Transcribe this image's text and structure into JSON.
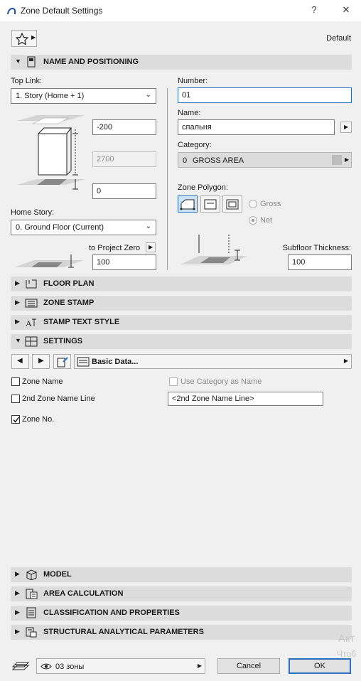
{
  "window": {
    "title": "Zone Default Settings",
    "help": "?",
    "close": "✕"
  },
  "header": {
    "preset": "Default"
  },
  "name_positioning": {
    "title": "NAME AND POSITIONING",
    "top_link_label": "Top Link:",
    "top_link_value": "1. Story (Home + 1)",
    "top_offset": "-200",
    "height": "2700",
    "bottom_offset": "0",
    "home_story_label": "Home Story:",
    "home_story_value": "0. Ground Floor (Current)",
    "to_project_zero_label": "to Project Zero",
    "project_zero_value": "100",
    "number_label": "Number:",
    "number_value": "01",
    "name_label": "Name:",
    "name_value": "спальня",
    "category_label": "Category:",
    "category_number": "0",
    "category_value": "GROSS AREA",
    "category_color": "#bdbdbd",
    "zone_polygon_label": "Zone Polygon:",
    "gross_label": "Gross",
    "net_label": "Net",
    "subfloor_label": "Subfloor Thickness:",
    "subfloor_value": "100"
  },
  "sections": {
    "floor_plan": "FLOOR PLAN",
    "zone_stamp": "ZONE STAMP",
    "stamp_text_style": "STAMP TEXT STYLE",
    "settings": "SETTINGS",
    "model": "MODEL",
    "area_calculation": "AREA CALCULATION",
    "classification": "CLASSIFICATION AND PROPERTIES",
    "structural": "STRUCTURAL ANALYTICAL PARAMETERS"
  },
  "settings_panel": {
    "dropdown_value": "Basic Data...",
    "zone_name_label": "Zone Name",
    "use_category_label": "Use Category as Name",
    "second_line_label": "2nd Zone Name Line",
    "second_line_value": "<2nd Zone Name Line>",
    "zone_no_label": "Zone No.",
    "zone_no_checked": true
  },
  "footer": {
    "layer_value": "03 зоны",
    "cancel": "Cancel",
    "ok": "OK"
  },
  "watermark": {
    "line1": "Акт",
    "line2": "Чтоб"
  }
}
